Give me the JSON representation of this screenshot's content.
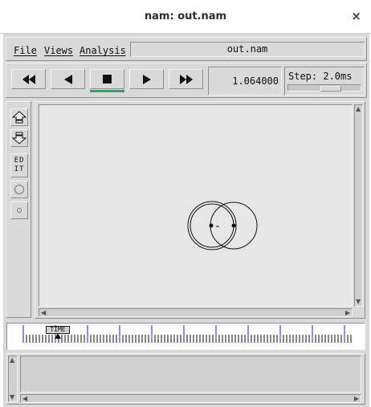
{
  "window": {
    "title": "nam: out.nam",
    "close_glyph": "×"
  },
  "menubar": {
    "items": [
      "File",
      "Views",
      "Analysis"
    ],
    "filename": "out.nam"
  },
  "playback": {
    "buttons": [
      "rewind-icon",
      "play-backward-icon",
      "stop-icon",
      "play-forward-icon",
      "fast-forward-icon"
    ],
    "time": "1.064000",
    "step_label": "Step: 2.0ms",
    "active_button": "stop",
    "active_color": "#3e9a6a"
  },
  "toolbar": {
    "items": [
      "zoom-in-icon",
      "zoom-out-icon",
      "edit-icon",
      "circle-icon",
      "small-circle-icon"
    ],
    "edit_label_line1": "ED",
    "edit_label_line2": "IT"
  },
  "timeline": {
    "label": "TIME",
    "tick_color": "#2222aa"
  }
}
